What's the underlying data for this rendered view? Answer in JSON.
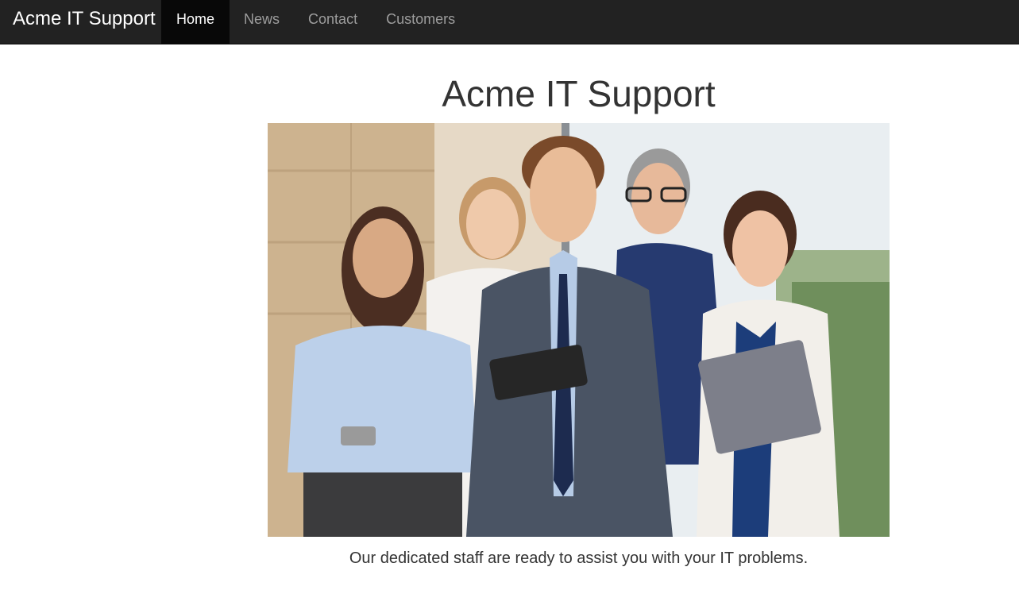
{
  "navbar": {
    "brand": "Acme IT Support",
    "items": [
      {
        "label": "Home",
        "active": true
      },
      {
        "label": "News",
        "active": false
      },
      {
        "label": "Contact",
        "active": false
      },
      {
        "label": "Customers",
        "active": false
      }
    ]
  },
  "main": {
    "title": "Acme IT Support",
    "caption": "Our dedicated staff are ready to assist you with your IT problems."
  },
  "colors": {
    "navbar_bg": "#222222",
    "nav_active_bg": "#080808",
    "nav_text": "#9d9d9d",
    "text": "#333333"
  }
}
